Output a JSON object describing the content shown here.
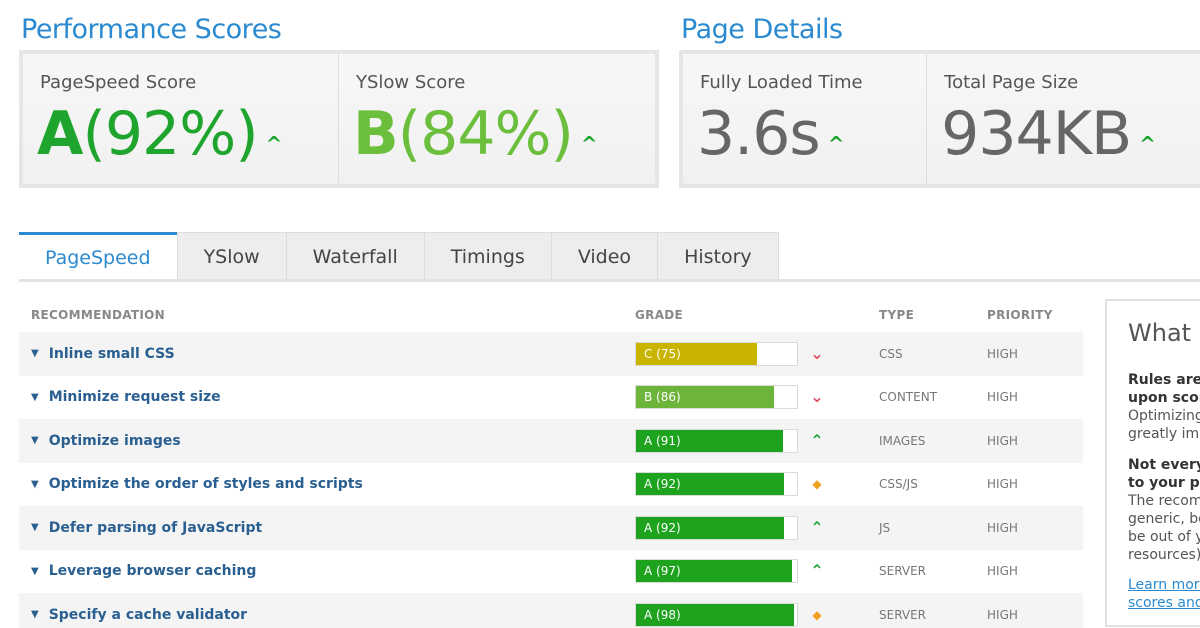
{
  "performance": {
    "title": "Performance Scores",
    "pagespeed": {
      "label": "PageSpeed Score",
      "grade": "A",
      "percent": "(92%)"
    },
    "yslow": {
      "label": "YSlow Score",
      "grade": "B",
      "percent": "(84%)"
    }
  },
  "details": {
    "title": "Page Details",
    "load_time": {
      "label": "Fully Loaded Time",
      "value": "3.6s"
    },
    "page_size": {
      "label": "Total Page Size",
      "value": "934KB"
    }
  },
  "tabs": [
    "PageSpeed",
    "YSlow",
    "Waterfall",
    "Timings",
    "Video",
    "History"
  ],
  "active_tab": "PageSpeed",
  "table": {
    "headers": {
      "recommendation": "RECOMMENDATION",
      "grade": "GRADE",
      "type": "TYPE",
      "priority": "PRIORITY"
    },
    "rows": [
      {
        "recommendation": "Inline small CSS",
        "grade": "C (75)",
        "score": 75,
        "color": "#c9b400",
        "trend": "down",
        "type": "CSS",
        "priority": "HIGH"
      },
      {
        "recommendation": "Minimize request size",
        "grade": "B (86)",
        "score": 86,
        "color": "#6db43a",
        "trend": "down",
        "type": "CONTENT",
        "priority": "HIGH"
      },
      {
        "recommendation": "Optimize images",
        "grade": "A (91)",
        "score": 91,
        "color": "#1ea31e",
        "trend": "up",
        "type": "IMAGES",
        "priority": "HIGH"
      },
      {
        "recommendation": "Optimize the order of styles and scripts",
        "grade": "A (92)",
        "score": 92,
        "color": "#1ea31e",
        "trend": "same",
        "type": "CSS/JS",
        "priority": "HIGH"
      },
      {
        "recommendation": "Defer parsing of JavaScript",
        "grade": "A (92)",
        "score": 92,
        "color": "#1ea31e",
        "trend": "up",
        "type": "JS",
        "priority": "HIGH"
      },
      {
        "recommendation": "Leverage browser caching",
        "grade": "A (97)",
        "score": 97,
        "color": "#1ea31e",
        "trend": "up",
        "type": "SERVER",
        "priority": "HIGH"
      },
      {
        "recommendation": "Specify a cache validator",
        "grade": "A (98)",
        "score": 98,
        "color": "#1ea31e",
        "trend": "same",
        "type": "SERVER",
        "priority": "HIGH"
      }
    ]
  },
  "trend_icons": {
    "down": "chevron-down-icon",
    "up": "chevron-up-icon",
    "same": "diamond-icon"
  },
  "trend_colors": {
    "down": "#e0495e",
    "up": "#22a33a",
    "same": "#f0a020"
  },
  "sidebar": {
    "title": "What d",
    "p1_bold_1": "Rules are",
    "p1_bold_2": "upon scor",
    "p1_text_1": "Optimizing",
    "p1_text_2": "greatly imp",
    "p2_bold_1": "Not every",
    "p2_bold_2": "to your pa",
    "p2_text_1": "The recom",
    "p2_text_2": "generic, be",
    "p2_text_3": "be out of yo",
    "p2_text_4": "resources)",
    "link_1": "Learn more",
    "link_2": "scores and"
  }
}
